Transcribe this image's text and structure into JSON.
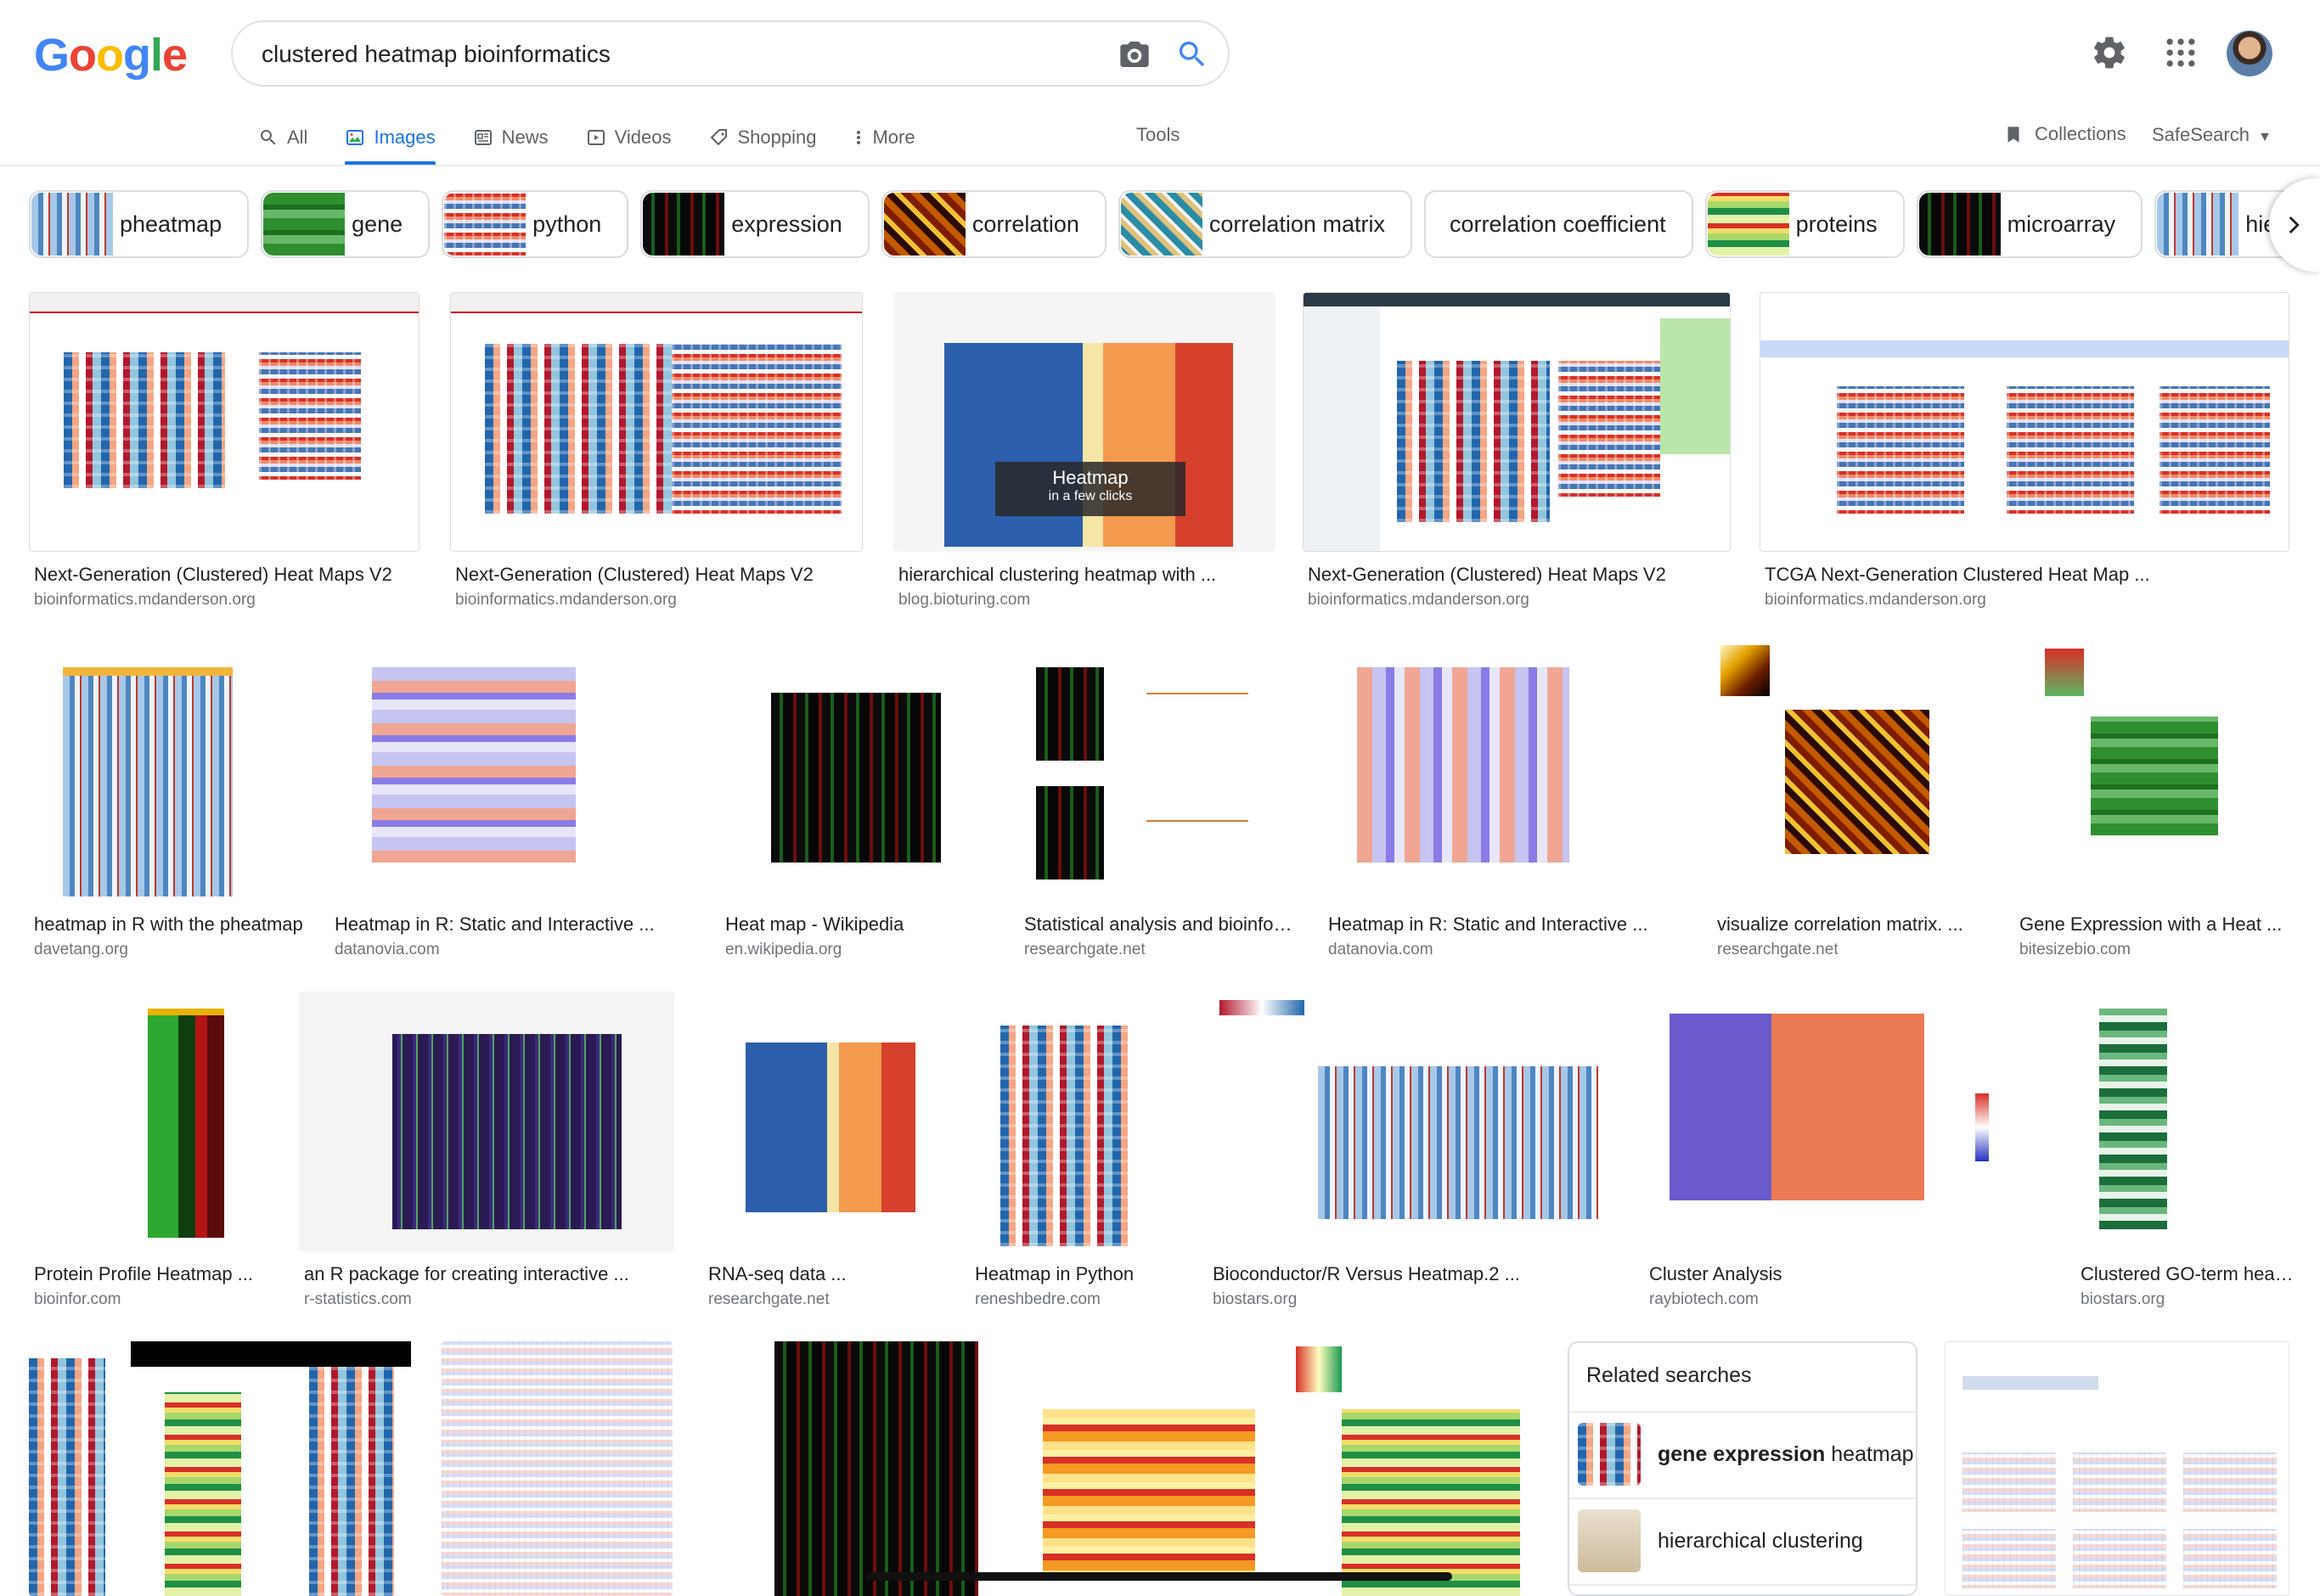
{
  "logo": {
    "letters": [
      "G",
      "o",
      "o",
      "g",
      "l",
      "e"
    ]
  },
  "search": {
    "query": "clustered heatmap bioinformatics"
  },
  "tabs": [
    {
      "label": "All",
      "icon": "search-icon"
    },
    {
      "label": "Images",
      "icon": "image-icon"
    },
    {
      "label": "News",
      "icon": "news-icon"
    },
    {
      "label": "Videos",
      "icon": "play-icon"
    },
    {
      "label": "Shopping",
      "icon": "tag-icon"
    },
    {
      "label": "More",
      "icon": "more-vert-icon"
    }
  ],
  "active_tab": "Images",
  "toolbar": {
    "tools": "Tools",
    "collections": "Collections",
    "safesearch": "SafeSearch"
  },
  "chips": [
    "pheatmap",
    "gene",
    "python",
    "expression",
    "correlation",
    "correlation matrix",
    "correlation coefficient",
    "proteins",
    "microarray",
    "hierarchical"
  ],
  "results": {
    "row1": [
      {
        "title": "Next-Generation (Clustered) Heat Maps V2",
        "source": "bioinformatics.mdanderson.org"
      },
      {
        "title": "Next-Generation (Clustered) Heat Maps V2",
        "source": "bioinformatics.mdanderson.org"
      },
      {
        "title": "hierarchical clustering heatmap with ...",
        "source": "blog.bioturing.com",
        "overlay_title": "Heatmap",
        "overlay_sub": "in a few clicks"
      },
      {
        "title": "Next-Generation (Clustered) Heat Maps V2",
        "source": "bioinformatics.mdanderson.org"
      },
      {
        "title": "TCGA Next-Generation Clustered Heat Map ...",
        "source": "bioinformatics.mdanderson.org"
      }
    ],
    "row2": [
      {
        "title": "heatmap in R with the pheatmap",
        "source": "davetang.org"
      },
      {
        "title": "Heatmap in R: Static and Interactive ...",
        "source": "datanovia.com"
      },
      {
        "title": "Heat map - Wikipedia",
        "source": "en.wikipedia.org"
      },
      {
        "title": "Statistical analysis and bioinformatics",
        "source": "researchgate.net"
      },
      {
        "title": "Heatmap in R: Static and Interactive ...",
        "source": "datanovia.com"
      },
      {
        "title": "visualize correlation matrix. ...",
        "source": "researchgate.net"
      },
      {
        "title": "Gene Expression with a Heat ...",
        "source": "bitesizebio.com"
      }
    ],
    "row3": [
      {
        "title": "Protein Profile Heatmap ...",
        "source": "bioinfor.com"
      },
      {
        "title": "an R package for creating interactive ...",
        "source": "r-statistics.com"
      },
      {
        "title": "RNA-seq data ...",
        "source": "researchgate.net"
      },
      {
        "title": "Heatmap in Python",
        "source": "reneshbedre.com"
      },
      {
        "title": "Bioconductor/R Versus Heatmap.2 ...",
        "source": "biostars.org"
      },
      {
        "title": "Cluster Analysis",
        "source": "raybiotech.com"
      },
      {
        "title": "Clustered GO-term heatmap",
        "source": "biostars.org"
      }
    ]
  },
  "related": {
    "heading": "Related searches",
    "items": [
      {
        "bold": "gene expression",
        "rest": " heatmap"
      },
      {
        "bold": "",
        "rest": "hierarchical clustering"
      }
    ]
  },
  "colors": {
    "accent": "#1a73e8",
    "text": "#202124",
    "secondary": "#70757a"
  }
}
